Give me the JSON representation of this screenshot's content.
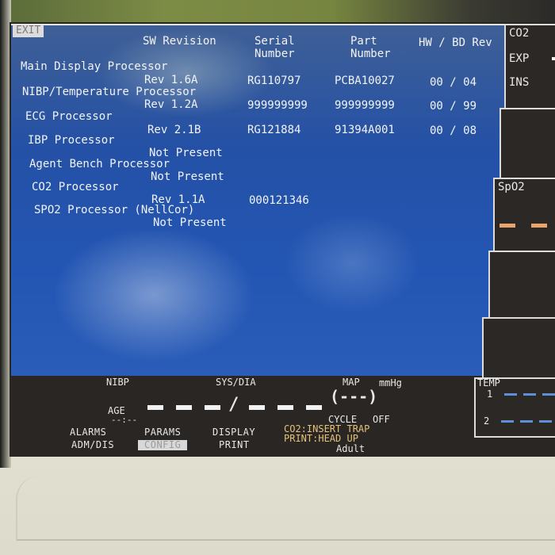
{
  "exit_label": "EXIT",
  "columns": {
    "sw_revision": "SW Revision",
    "serial_number": [
      "Serial",
      "Number"
    ],
    "part_number": [
      "Part",
      "Number"
    ],
    "hw_bd_rev": "HW / BD Rev"
  },
  "processors": [
    {
      "name": "Main Display Processor",
      "sw_revision": "Rev 1.6A",
      "serial": "RG110797",
      "part": "PCBA10027",
      "hw_bd": "00 / 04"
    },
    {
      "name": "NIBP/Temperature Processor",
      "sw_revision": "Rev 1.2A",
      "serial": "999999999",
      "part": "999999999",
      "hw_bd": "00 / 99"
    },
    {
      "name": "ECG Processor",
      "sw_revision": "Rev 2.1B",
      "serial": "RG121884",
      "part": "91394A001",
      "hw_bd": "00 / 08"
    },
    {
      "name": "IBP Processor",
      "sw_revision": "Not Present"
    },
    {
      "name": "Agent Bench Processor",
      "sw_revision": "Not Present"
    },
    {
      "name": "CO2 Processor",
      "sw_revision": "Rev 1.1A",
      "serial": "000121346"
    },
    {
      "name": "SPO2 Processor (NellCor)",
      "sw_revision": "Not Present"
    }
  ],
  "side_panels": {
    "co2": {
      "title": "CO2",
      "exp": "EXP",
      "ins": "INS"
    },
    "spo2": {
      "title": "SpO2"
    },
    "temp": {
      "title": "TEMP",
      "ch1": "1",
      "ch2": "2"
    }
  },
  "nibp": {
    "label": "NIBP",
    "sys_dia": "SYS/DIA",
    "age_label": "AGE",
    "age_value": "--:--",
    "map_label": "MAP",
    "unit": "mmHg",
    "map_value": "(---)",
    "cycle_label": "CYCLE",
    "cycle_value": "OFF"
  },
  "messages": [
    "CO2:INSERT TRAP",
    "PRINT:HEAD UP"
  ],
  "patient_mode": "Adult",
  "menu": {
    "alarms": "ALARMS",
    "adm_dis": "ADM/DIS",
    "params": "PARAMS",
    "config": "CONFIG",
    "display": "DISPLAY",
    "print": "PRINT"
  }
}
